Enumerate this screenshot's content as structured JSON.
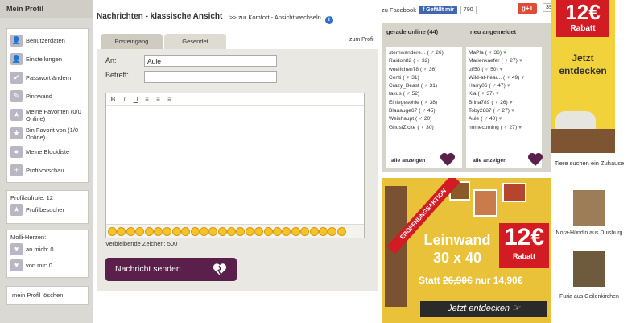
{
  "sidebar": {
    "title": "Mein Profil",
    "menu": [
      {
        "label": "Benutzerdaten",
        "icon": "user-icon"
      },
      {
        "label": "Einstellungen",
        "icon": "user-settings-icon"
      },
      {
        "label": "Passwort ändern",
        "icon": "checkmark-icon"
      },
      {
        "label": "Pinnwand",
        "icon": "pin-icon"
      },
      {
        "label": "Meine Favoriten (0/0 Online)",
        "icon": "star-icon"
      },
      {
        "label": "Bin Favorit von (1/0 Online)",
        "icon": "star-icon"
      },
      {
        "label": "Meine Blockliste",
        "icon": "block-icon"
      },
      {
        "label": "Profilvorschau",
        "icon": "plus-icon"
      }
    ],
    "profile_views_label": "Profilaufrufe: 12",
    "profile_visitors_label": "Profilbesucher",
    "molli_title": "Molli-Herzen:",
    "molli_to_me": "an mich: 0",
    "molli_from_me": "von mir: 0",
    "delete_profile": "mein Profil löschen"
  },
  "main": {
    "title": "Nachrichten - klassische Ansicht",
    "switch_link": ">> zur Komfort - Ansicht wechseln",
    "tabs": [
      "Posteingang",
      "Gesendet"
    ],
    "zum_profil": "zum Profil",
    "to_label": "An:",
    "to_value": "Aule",
    "subject_label": "Betreff:",
    "subject_value": "",
    "editor_buttons": [
      "B",
      "I",
      "U",
      "≡",
      "≡",
      "≡"
    ],
    "remaining_chars": "Verbleibende Zeichen: 500",
    "send_button": "Nachricht senden"
  },
  "social": {
    "facebook_label": "zu Facebook",
    "like_button": "Gefällt mir",
    "like_count": "790",
    "gplus_label": "g+1",
    "gplus_count": "39"
  },
  "online": {
    "header": "gerade online (44)",
    "users": [
      {
        "name": "sternwandere...",
        "age": "( ♂ 26)"
      },
      {
        "name": "Raidon82",
        "age": "( ♂ 32)"
      },
      {
        "name": "woelfchen78",
        "age": "( ♂ 36)"
      },
      {
        "name": "Centi",
        "age": "( ♀ 31)"
      },
      {
        "name": "Crazy_Beast",
        "age": "( ♂ 31)"
      },
      {
        "name": "taxus",
        "age": "( ♂ 52)"
      },
      {
        "name": "Einlegesohle",
        "age": "( ♂ 38)"
      },
      {
        "name": "Blauauge67",
        "age": "( ♂ 45)"
      },
      {
        "name": "Weishaupt",
        "age": "( ♂ 20)"
      },
      {
        "name": "GhostZicke",
        "age": "( ♀ 30)"
      }
    ],
    "all_link": "alle anzeigen"
  },
  "newusers": {
    "header": "neu angemeldet",
    "users": [
      {
        "name": "MaPla",
        "age": "( ♀ 36)"
      },
      {
        "name": "Marienkaefer",
        "age": "( ♀ 27)"
      },
      {
        "name": "ulf50",
        "age": "( ♂ 50)"
      },
      {
        "name": "Wild-at-hear...",
        "age": "( ♀ 49)"
      },
      {
        "name": "Harry06",
        "age": "( ♂ 47)"
      },
      {
        "name": "Kia",
        "age": "( ♀ 37)"
      },
      {
        "name": "Brina789",
        "age": "( ♀ 26)"
      },
      {
        "name": "Toby2887",
        "age": "( ♂ 27)"
      },
      {
        "name": "Aule",
        "age": "( ♂ 40)"
      },
      {
        "name": "homecoming",
        "age": "( ♂ 27)"
      }
    ],
    "all_link": "alle anzeigen"
  },
  "ad_top": {
    "price": "12€",
    "price_sub": "Rabatt",
    "cta": "Jetzt entdecken"
  },
  "ad_big": {
    "ribbon": "ERÖFFNUNGSAKTION",
    "headline": "Leinwand 30 x 40",
    "price": "12€",
    "price_sub": "Rabatt",
    "offer_prefix": "Statt ",
    "offer_old": "26,90€",
    "offer_new": " nur 14,90€",
    "cta": "Jetzt entdecken"
  },
  "dogs": {
    "title": "Tiere suchen ein Zuhause",
    "items": [
      {
        "caption": "Nora-Hündin aus Duisburg"
      },
      {
        "caption": "Furia aus Geilenkirchen"
      }
    ]
  }
}
